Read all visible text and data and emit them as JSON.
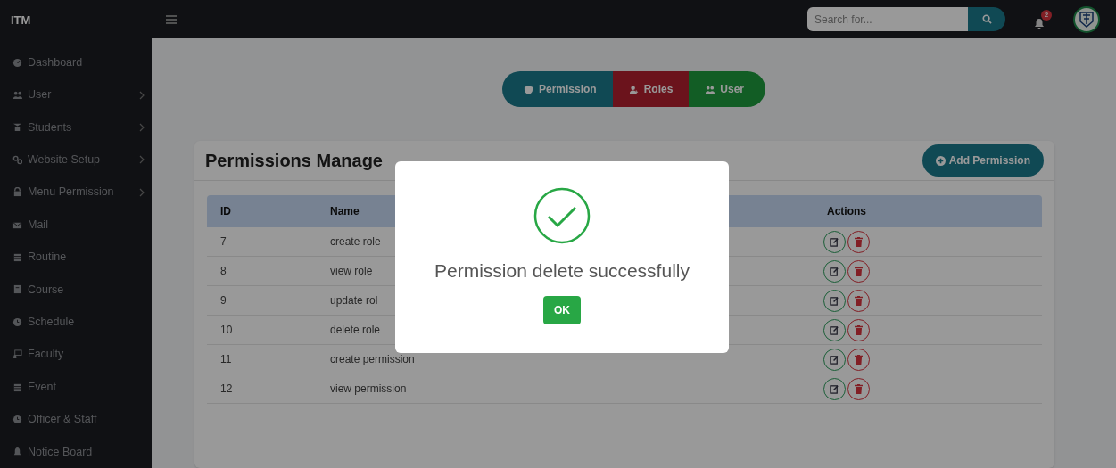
{
  "brand": "ITM",
  "search": {
    "placeholder": "Search for..."
  },
  "notifications": {
    "count": "2"
  },
  "sidebar": {
    "items": [
      {
        "label": "Dashboard",
        "has_submenu": false
      },
      {
        "label": "User",
        "has_submenu": true
      },
      {
        "label": "Students",
        "has_submenu": true
      },
      {
        "label": "Website Setup",
        "has_submenu": true
      },
      {
        "label": "Menu Permission",
        "has_submenu": true
      },
      {
        "label": "Mail",
        "has_submenu": false
      },
      {
        "label": "Routine",
        "has_submenu": false
      },
      {
        "label": "Course",
        "has_submenu": false
      },
      {
        "label": "Schedule",
        "has_submenu": false
      },
      {
        "label": "Faculty",
        "has_submenu": false
      },
      {
        "label": "Event",
        "has_submenu": false
      },
      {
        "label": "Officer & Staff",
        "has_submenu": false
      },
      {
        "label": "Notice Board",
        "has_submenu": false
      }
    ]
  },
  "tabs": [
    {
      "label": "Permission"
    },
    {
      "label": "Roles"
    },
    {
      "label": "User"
    }
  ],
  "card": {
    "title": "Permissions Manage",
    "add_button": "Add Permission"
  },
  "table": {
    "columns": [
      "ID",
      "Name",
      "Actions"
    ],
    "rows": [
      {
        "id": "7",
        "name": "create role"
      },
      {
        "id": "8",
        "name": "view role"
      },
      {
        "id": "9",
        "name": "update rol"
      },
      {
        "id": "10",
        "name": "delete role"
      },
      {
        "id": "11",
        "name": "create permission"
      },
      {
        "id": "12",
        "name": "view permission"
      }
    ]
  },
  "dialog": {
    "message": "Permission delete successfully",
    "button": "OK"
  }
}
